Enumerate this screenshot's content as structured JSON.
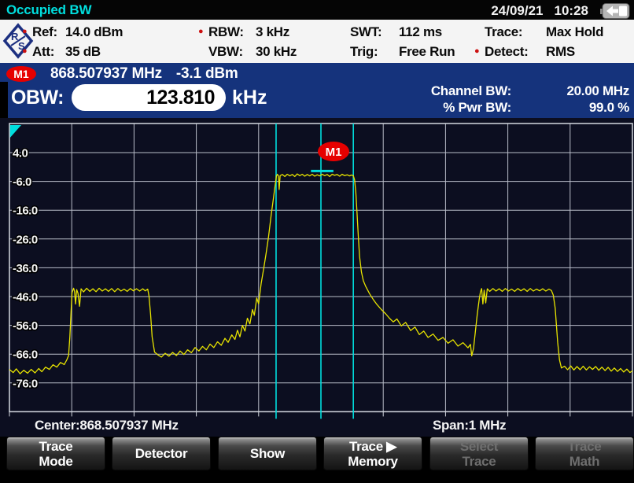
{
  "title_bar": {
    "title": "Occupied BW",
    "date": "24/09/21",
    "time": "10:28",
    "battery_icon": "battery-charging"
  },
  "settings": {
    "items": [
      {
        "dot": "●",
        "label": "Ref:",
        "value": "14.0 dBm"
      },
      {
        "dot": "●",
        "label": "Att:",
        "value": "35 dB"
      },
      {
        "dot": "●",
        "label": "RBW:",
        "value": "3 kHz"
      },
      {
        "dot": "",
        "label": "VBW:",
        "value": "30 kHz"
      },
      {
        "dot": "",
        "label": "SWT:",
        "value": "112 ms"
      },
      {
        "dot": "",
        "label": "Trig:",
        "value": "Free Run"
      },
      {
        "dot": "",
        "label": "Trace:",
        "value": "Max Hold"
      },
      {
        "dot": "●",
        "label": "Detect:",
        "value": "RMS"
      }
    ]
  },
  "marker_bar": {
    "marker_name": "M1",
    "marker_freq": "868.507937 MHz",
    "marker_level": "-3.1 dBm",
    "obw_label": "OBW:",
    "obw_value": "123.810",
    "obw_unit": "kHz",
    "channel_bw_label": "Channel BW:",
    "channel_bw_value": "20.00 MHz",
    "pwr_bw_label": "% Pwr BW:",
    "pwr_bw_value": "99.0 %"
  },
  "axis_bar": {
    "center": "Center:868.507937 MHz",
    "span": "Span:1 MHz"
  },
  "softkeys": [
    {
      "line1": "Trace",
      "line2": "Mode",
      "enabled": true
    },
    {
      "line1": "Detector",
      "line2": "",
      "enabled": true
    },
    {
      "line1": "Show",
      "line2": "",
      "enabled": true
    },
    {
      "line1": "Trace ▶",
      "line2": "Memory",
      "enabled": true
    },
    {
      "line1": "Select",
      "line2": "Trace",
      "enabled": false
    },
    {
      "line1": "Trace",
      "line2": "Math",
      "enabled": false
    }
  ],
  "chart_data": {
    "type": "line",
    "title": "Occupied BW spectrum, Max Hold trace",
    "x_axis": {
      "center_mhz": 868.507937,
      "span_mhz": 1.0,
      "divisions": 10,
      "unit": "kHz offset from center"
    },
    "y_axis": {
      "unit": "dBm",
      "ref_dbm": 14.0,
      "db_per_div": 10,
      "tick_labels": [
        "4.0",
        "-6.0",
        "-16.0",
        "-26.0",
        "-36.0",
        "-46.0",
        "-56.0",
        "-66.0",
        "-76.0"
      ]
    },
    "marker": {
      "name": "M1",
      "freq_mhz": 868.507937,
      "level_dbm": -3.1,
      "offset_khz": 0
    },
    "marker_line_khz": 0,
    "obw_lines_khz": [
      -72.0,
      52.0
    ],
    "marker_peak_segment": {
      "from_khz": -16,
      "to_khz": 20,
      "level_dbm": -2.4
    },
    "colors": {
      "trace": "#e8e400",
      "cyan": "#00dede",
      "grid": "#b9bdc9",
      "frame": "#d4d8e0",
      "bg": "#0c0e20",
      "marker_badge": "#e60000"
    },
    "trace_points": [
      [
        -500,
        -71.3
      ],
      [
        -494,
        -72.4
      ],
      [
        -489,
        -71.1
      ],
      [
        -483,
        -72.8
      ],
      [
        -477,
        -71.6
      ],
      [
        -471,
        -72.6
      ],
      [
        -465,
        -71.3
      ],
      [
        -459,
        -72.5
      ],
      [
        -453,
        -71.0
      ],
      [
        -448,
        -72.1
      ],
      [
        -442,
        -70.5
      ],
      [
        -436,
        -71.3
      ],
      [
        -430,
        -69.7
      ],
      [
        -424,
        -70.5
      ],
      [
        -418,
        -68.9
      ],
      [
        -412,
        -69.6
      ],
      [
        -408,
        -68.0
      ],
      [
        -405,
        -66.5
      ],
      [
        -403,
        -60.0
      ],
      [
        -401,
        -51.0
      ],
      [
        -399.5,
        -44.6
      ],
      [
        -397,
        -43.1
      ],
      [
        -395.5,
        -44.2
      ],
      [
        -394,
        -48.6
      ],
      [
        -392,
        -43.6
      ],
      [
        -390,
        -44.8
      ],
      [
        -387.5,
        -49.4
      ],
      [
        -385,
        -43.3
      ],
      [
        -381,
        -44.4
      ],
      [
        -376,
        -43.1
      ],
      [
        -371,
        -44.2
      ],
      [
        -366,
        -43.3
      ],
      [
        -361,
        -44.3
      ],
      [
        -356,
        -43.1
      ],
      [
        -351,
        -44.1
      ],
      [
        -346,
        -43.3
      ],
      [
        -341,
        -44.2
      ],
      [
        -336,
        -43.2
      ],
      [
        -331,
        -44.3
      ],
      [
        -326,
        -43.2
      ],
      [
        -321,
        -44.1
      ],
      [
        -316,
        -43.4
      ],
      [
        -311,
        -44.2
      ],
      [
        -306,
        -43.2
      ],
      [
        -301,
        -44.0
      ],
      [
        -296,
        -43.3
      ],
      [
        -291,
        -44.1
      ],
      [
        -286,
        -43.3
      ],
      [
        -282,
        -44.0
      ],
      [
        -278,
        -43.4
      ],
      [
        -276,
        -45.8
      ],
      [
        -273.5,
        -52.0
      ],
      [
        -271,
        -60.0
      ],
      [
        -267,
        -65.3
      ],
      [
        -262,
        -66.2
      ],
      [
        -256,
        -67.0
      ],
      [
        -250,
        -65.7
      ],
      [
        -244,
        -66.7
      ],
      [
        -238,
        -65.4
      ],
      [
        -232,
        -66.5
      ],
      [
        -226,
        -64.9
      ],
      [
        -220,
        -66.1
      ],
      [
        -214,
        -64.5
      ],
      [
        -208,
        -65.5
      ],
      [
        -202,
        -63.7
      ],
      [
        -196,
        -64.9
      ],
      [
        -190,
        -63.3
      ],
      [
        -184,
        -64.5
      ],
      [
        -178,
        -62.5
      ],
      [
        -172,
        -63.7
      ],
      [
        -166,
        -61.7
      ],
      [
        -160,
        -62.9
      ],
      [
        -154,
        -60.5
      ],
      [
        -149,
        -61.9
      ],
      [
        -143,
        -59.3
      ],
      [
        -138,
        -60.9
      ],
      [
        -134,
        -57.7
      ],
      [
        -130,
        -60.0
      ],
      [
        -126,
        -56.0
      ],
      [
        -122,
        -58.0
      ],
      [
        -118,
        -53.5
      ],
      [
        -114,
        -55.5
      ],
      [
        -110,
        -50.5
      ],
      [
        -107,
        -52.5
      ],
      [
        -103,
        -46.5
      ],
      [
        -100,
        -48.5
      ],
      [
        -96,
        -41.5
      ],
      [
        -92,
        -36.5
      ],
      [
        -88,
        -31.0
      ],
      [
        -84,
        -25.0
      ],
      [
        -80,
        -18.0
      ],
      [
        -76,
        -11.5
      ],
      [
        -73,
        -6.5
      ],
      [
        -71.5,
        -4.2
      ],
      [
        -70,
        -3.5
      ],
      [
        -68,
        -4.2
      ],
      [
        -67,
        -8.8
      ],
      [
        -65.5,
        -4.0
      ],
      [
        -62,
        -3.6
      ],
      [
        -58,
        -4.3
      ],
      [
        -54,
        -3.5
      ],
      [
        -50,
        -4.1
      ],
      [
        -46,
        -3.6
      ],
      [
        -42,
        -4.3
      ],
      [
        -38,
        -3.4
      ],
      [
        -34,
        -4.0
      ],
      [
        -30,
        -3.5
      ],
      [
        -26,
        -4.2
      ],
      [
        -22,
        -3.6
      ],
      [
        -18,
        -4.1
      ],
      [
        -14,
        -3.5
      ],
      [
        -10,
        -4.2
      ],
      [
        -6,
        -3.7
      ],
      [
        -2,
        -4.1
      ],
      [
        2,
        -3.5
      ],
      [
        6,
        -4.0
      ],
      [
        10,
        -3.6
      ],
      [
        14,
        -4.3
      ],
      [
        18,
        -3.5
      ],
      [
        22,
        -3.9
      ],
      [
        26,
        -3.6
      ],
      [
        30,
        -4.2
      ],
      [
        34,
        -3.5
      ],
      [
        38,
        -4.0
      ],
      [
        42,
        -3.7
      ],
      [
        46,
        -4.1
      ],
      [
        49,
        -3.8
      ],
      [
        52,
        -4.0
      ],
      [
        54,
        -5.5
      ],
      [
        56,
        -10.0
      ],
      [
        58,
        -17.0
      ],
      [
        60,
        -25.0
      ],
      [
        62,
        -32.0
      ],
      [
        65,
        -37.5
      ],
      [
        68,
        -40.5
      ],
      [
        72,
        -42.5
      ],
      [
        78,
        -45.0
      ],
      [
        84,
        -47.0
      ],
      [
        90,
        -48.8
      ],
      [
        97,
        -50.5
      ],
      [
        104,
        -52.0
      ],
      [
        110,
        -53.5
      ],
      [
        116,
        -54.8
      ],
      [
        122,
        -53.8
      ],
      [
        129,
        -56.2
      ],
      [
        136,
        -55.0
      ],
      [
        144,
        -57.8
      ],
      [
        151,
        -56.6
      ],
      [
        158,
        -59.2
      ],
      [
        165,
        -58.0
      ],
      [
        172,
        -60.2
      ],
      [
        180,
        -59.0
      ],
      [
        188,
        -61.2
      ],
      [
        196,
        -60.2
      ],
      [
        204,
        -62.2
      ],
      [
        212,
        -61.0
      ],
      [
        220,
        -63.2
      ],
      [
        228,
        -62.0
      ],
      [
        236,
        -63.8
      ],
      [
        240,
        -62.6
      ],
      [
        242,
        -66.6
      ],
      [
        245,
        -64.0
      ],
      [
        248,
        -58.0
      ],
      [
        251,
        -52.0
      ],
      [
        254,
        -47.0
      ],
      [
        256,
        -44.3
      ],
      [
        258,
        -43.2
      ],
      [
        260,
        -48.6
      ],
      [
        262,
        -43.8
      ],
      [
        264.5,
        -48.2
      ],
      [
        267,
        -43.3
      ],
      [
        271,
        -44.2
      ],
      [
        276,
        -43.2
      ],
      [
        281,
        -44.1
      ],
      [
        286,
        -43.3
      ],
      [
        291,
        -44.2
      ],
      [
        296,
        -43.2
      ],
      [
        301,
        -44.1
      ],
      [
        306,
        -43.4
      ],
      [
        311,
        -44.2
      ],
      [
        316,
        -43.2
      ],
      [
        321,
        -44.0
      ],
      [
        326,
        -43.3
      ],
      [
        331,
        -44.2
      ],
      [
        336,
        -43.2
      ],
      [
        341,
        -44.1
      ],
      [
        346,
        -43.4
      ],
      [
        351,
        -44.0
      ],
      [
        356,
        -43.3
      ],
      [
        361,
        -44.1
      ],
      [
        366,
        -43.4
      ],
      [
        370,
        -43.9
      ],
      [
        373,
        -45.5
      ],
      [
        376,
        -50.0
      ],
      [
        378,
        -56.0
      ],
      [
        380,
        -62.0
      ],
      [
        383,
        -68.0
      ],
      [
        386,
        -70.8
      ],
      [
        391,
        -70.2
      ],
      [
        396,
        -71.4
      ],
      [
        401,
        -70.1
      ],
      [
        406,
        -71.5
      ],
      [
        411,
        -70.3
      ],
      [
        416,
        -71.4
      ],
      [
        421,
        -70.2
      ],
      [
        426,
        -71.5
      ],
      [
        431,
        -70.4
      ],
      [
        436,
        -71.3
      ],
      [
        441,
        -70.3
      ],
      [
        446,
        -71.6
      ],
      [
        451,
        -70.5
      ],
      [
        456,
        -71.7
      ],
      [
        461,
        -70.6
      ],
      [
        466,
        -71.9
      ],
      [
        471,
        -70.8
      ],
      [
        476,
        -72.0
      ],
      [
        481,
        -71.0
      ],
      [
        486,
        -72.2
      ],
      [
        491,
        -71.2
      ],
      [
        496,
        -72.4
      ],
      [
        500,
        -71.8
      ]
    ]
  }
}
